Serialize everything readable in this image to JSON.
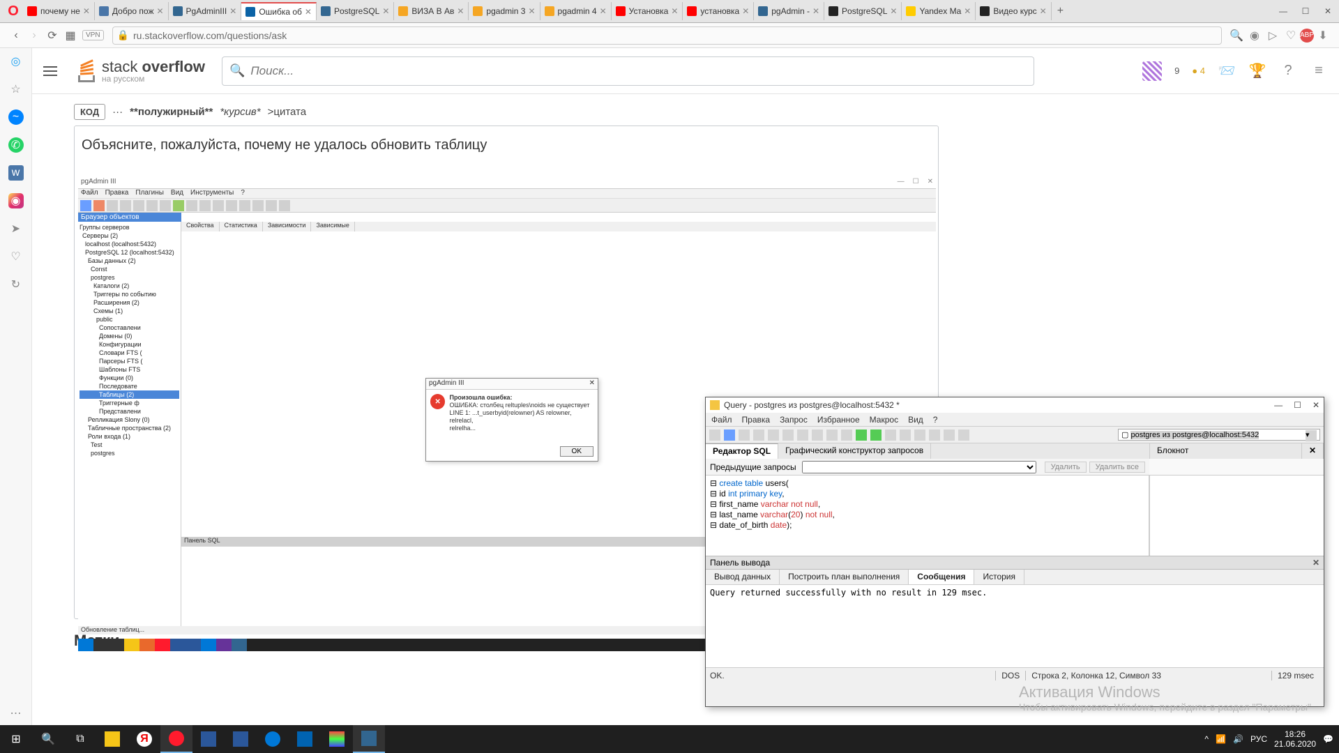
{
  "browser": {
    "tabs": [
      {
        "title": "почему не",
        "fav": "#ff0000"
      },
      {
        "title": "Добро пож",
        "fav": "#4a76a8"
      },
      {
        "title": "PgAdminIII",
        "fav": "#326690"
      },
      {
        "title": "Ошибка об",
        "fav": "#0b63a6",
        "active": true
      },
      {
        "title": "PostgreSQL",
        "fav": "#336791"
      },
      {
        "title": "ВИЗА В Ав",
        "fav": "#f5a623"
      },
      {
        "title": "pgadmin 3",
        "fav": "#f5a623"
      },
      {
        "title": "pgadmin 4",
        "fav": "#f5a623"
      },
      {
        "title": "Установка",
        "fav": "#ff0000"
      },
      {
        "title": "установка",
        "fav": "#ff0000"
      },
      {
        "title": "pgAdmin -",
        "fav": "#326690"
      },
      {
        "title": "PostgreSQL",
        "fav": "#222"
      },
      {
        "title": "Yandex Ma",
        "fav": "#ffcc00"
      },
      {
        "title": "Видео курс",
        "fav": "#222"
      }
    ],
    "url": "ru.stackoverflow.com/questions/ask",
    "vpn": "VPN"
  },
  "stackoverflow": {
    "logo_top": "stack overflow",
    "logo_bottom": "на русском",
    "search_placeholder": "Поиск...",
    "rep": "9",
    "badge": "● 4",
    "toolbar": {
      "code": "КОД",
      "bold": "**полужирный**",
      "italic": "*курсив*",
      "quote": ">цитата"
    },
    "body_text": "Объясните, пожалуйста, почему не удалось обновить таблицу",
    "tags_heading": "Метки"
  },
  "pgadmin": {
    "title": "pgAdmin III",
    "menu": [
      "Файл",
      "Правка",
      "Плагины",
      "Вид",
      "Инструменты",
      "?"
    ],
    "browser": "Браузер объектов",
    "tabs": [
      "Свойства",
      "Статистика",
      "Зависимости",
      "Зависимые"
    ],
    "sqlpanel": "Панель SQL",
    "status": "Обновление таблиц...",
    "tree": [
      "Группы серверов",
      " Серверы (2)",
      "  localhost (localhost:5432)",
      "  PostgreSQL 12 (localhost:5432)",
      "   Базы данных (2)",
      "    Const",
      "    postgres",
      "     Каталоги (2)",
      "     Триггеры по событию",
      "     Расширения (2)",
      "     Схемы (1)",
      "      public",
      "       Сопоставлени",
      "       Домены (0)",
      "       Конфигурации",
      "       Словари FTS (",
      "       Парсеры FTS (",
      "       Шаблоны FTS",
      "       Функции (0)",
      "       Последовате",
      "       Таблицы (2)",
      "       Триггерные ф",
      "       Представлени",
      "   Репликация Slony (0)",
      "   Табличные пространства (2)",
      "   Роли входа (1)",
      "    Test",
      "    postgres"
    ],
    "tree_selected": 20
  },
  "error": {
    "title": "pgAdmin III",
    "heading": "Произошла ошибка:",
    "msg": "ОШИБКА:  столбец reltuples\\noids не существует\nLINE 1: ...t_userbyid(relowner) AS relowner, relrelacl,\nrelrelha...",
    "ok": "OK"
  },
  "query": {
    "title": "Query - postgres из postgres@localhost:5432 *",
    "menu": [
      "Файл",
      "Правка",
      "Запрос",
      "Избранное",
      "Макрос",
      "Вид",
      "?"
    ],
    "conn": "postgres из postgres@localhost:5432",
    "tab_editor": "Редактор SQL",
    "tab_builder": "Графический конструктор запросов",
    "notepad": "Блокнот",
    "prev_label": "Предыдущие запросы",
    "delete": "Удалить",
    "delete_all": "Удалить все",
    "sql_lines": [
      {
        "t": "create table users("
      },
      {
        "t": "  id int primary key,"
      },
      {
        "t": "  first_name varchar not null,"
      },
      {
        "t": "  last_name varchar(20) not null,"
      },
      {
        "t": "  date_of_birth date);"
      }
    ],
    "out_panel": "Панель вывода",
    "out_tabs": [
      "Вывод данных",
      "Построить план выполнения",
      "Сообщения",
      "История"
    ],
    "out_active": 2,
    "out_text": "Query returned successfully with no result in 129 msec.",
    "status_ok": "OK.",
    "status_mid": "DOS",
    "status_pos": "Строка 2, Колонка 12, Символ 33",
    "status_time": "129 msec"
  },
  "activation": {
    "line1": "Активация Windows",
    "line2": "Чтобы активировать Windows, перейдите в раздел \"Параметры\""
  },
  "taskbar": {
    "time": "18:26",
    "date": "21.06.2020",
    "lang": "РУС"
  }
}
